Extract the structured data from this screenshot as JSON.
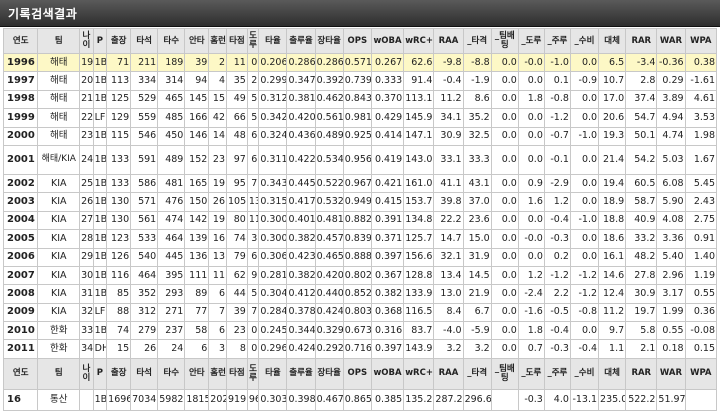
{
  "title": "기록검색결과",
  "headers": [
    "연도",
    "팀",
    "나이",
    "P",
    "출장",
    "타석",
    "타수",
    "안타",
    "홈런",
    "타점",
    "도루",
    "타율",
    "출루율",
    "장타율",
    "OPS",
    "wOBA",
    "wRC+",
    "RAA",
    "_타격",
    "_팀배팅",
    "_도루",
    "_주루",
    "_수비",
    "대체",
    "RAR",
    "WAR",
    "WPA"
  ],
  "headers_display": [
    "연도",
    "팀",
    "나\n이",
    "P",
    "출장",
    "타석",
    "타수",
    "안타",
    "홈런",
    "타점",
    "도\n루",
    "타율",
    "출루율",
    "장타율",
    "OPS",
    "wOBA",
    "wRC+",
    "RAA",
    "_타격",
    "_팀배\n팅",
    "_도루",
    "_주루",
    "_수비",
    "대체",
    "RAR",
    "WAR",
    "WPA"
  ],
  "rows": [
    [
      "1996",
      "해태",
      "19",
      "1B",
      "71",
      "211",
      "189",
      "39",
      "2",
      "11",
      "0",
      "0.206",
      "0.286",
      "0.286",
      "0.571",
      "0.267",
      "62.6",
      "-9.8",
      "-8.8",
      "0.0",
      "-0.0",
      "-1.0",
      "0.0",
      "6.5",
      "-3.4",
      "-0.36",
      "0.38"
    ],
    [
      "1997",
      "해태",
      "20",
      "1B",
      "113",
      "334",
      "314",
      "94",
      "4",
      "35",
      "2",
      "0.299",
      "0.347",
      "0.392",
      "0.739",
      "0.333",
      "91.4",
      "-0.4",
      "-1.9",
      "0.0",
      "0.0",
      "0.1",
      "-0.9",
      "10.7",
      "2.8",
      "0.29",
      "-1.61"
    ],
    [
      "1998",
      "해태",
      "21",
      "1B",
      "125",
      "529",
      "465",
      "145",
      "15",
      "49",
      "5",
      "0.312",
      "0.381",
      "0.462",
      "0.843",
      "0.370",
      "113.1",
      "11.2",
      "8.6",
      "0.0",
      "1.8",
      "-0.8",
      "0.0",
      "17.0",
      "37.4",
      "3.89",
      "4.61"
    ],
    [
      "1999",
      "해태",
      "22",
      "LF",
      "129",
      "559",
      "485",
      "166",
      "42",
      "66",
      "5",
      "0.342",
      "0.420",
      "0.561",
      "0.981",
      "0.429",
      "145.9",
      "34.1",
      "35.2",
      "0.0",
      "0.0",
      "-1.2",
      "0.0",
      "20.6",
      "54.7",
      "4.94",
      "3.53"
    ],
    [
      "2000",
      "해태",
      "23",
      "1B",
      "115",
      "546",
      "450",
      "146",
      "14",
      "48",
      "6",
      "0.324",
      "0.436",
      "0.489",
      "0.925",
      "0.414",
      "147.1",
      "30.9",
      "32.5",
      "0.0",
      "0.0",
      "-0.7",
      "-1.0",
      "19.3",
      "50.1",
      "4.74",
      "1.98"
    ],
    [
      "2001",
      "해태/KIA",
      "24",
      "1B",
      "133",
      "591",
      "489",
      "152",
      "23",
      "97",
      "6",
      "0.311",
      "0.422",
      "0.534",
      "0.956",
      "0.419",
      "143.0",
      "33.1",
      "33.3",
      "0.0",
      "0.0",
      "-0.1",
      "0.0",
      "21.4",
      "54.2",
      "5.03",
      "1.67"
    ],
    [
      "2002",
      "KIA",
      "25",
      "1B",
      "133",
      "586",
      "481",
      "165",
      "19",
      "95",
      "7",
      "0.343",
      "0.445",
      "0.522",
      "0.967",
      "0.421",
      "161.0",
      "41.1",
      "43.1",
      "0.0",
      "0.9",
      "-2.9",
      "0.0",
      "19.4",
      "60.5",
      "6.08",
      "5.45"
    ],
    [
      "2003",
      "KIA",
      "26",
      "1B",
      "130",
      "571",
      "476",
      "150",
      "26",
      "105",
      "13",
      "0.315",
      "0.417",
      "0.532",
      "0.949",
      "0.415",
      "153.7",
      "39.8",
      "37.0",
      "0.0",
      "1.6",
      "1.2",
      "0.0",
      "18.9",
      "58.7",
      "5.90",
      "2.43"
    ],
    [
      "2004",
      "KIA",
      "27",
      "1B",
      "130",
      "561",
      "474",
      "142",
      "19",
      "80",
      "11",
      "0.300",
      "0.401",
      "0.481",
      "0.882",
      "0.391",
      "134.8",
      "22.2",
      "23.6",
      "0.0",
      "0.0",
      "-0.4",
      "-1.0",
      "18.8",
      "40.9",
      "4.08",
      "2.75"
    ],
    [
      "2005",
      "KIA",
      "28",
      "1B",
      "123",
      "533",
      "464",
      "139",
      "16",
      "74",
      "3",
      "0.300",
      "0.382",
      "0.457",
      "0.839",
      "0.371",
      "125.7",
      "14.7",
      "15.0",
      "0.0",
      "-0.0",
      "-0.3",
      "0.0",
      "18.6",
      "33.2",
      "3.36",
      "0.91"
    ],
    [
      "2006",
      "KIA",
      "29",
      "1B",
      "126",
      "540",
      "445",
      "136",
      "13",
      "79",
      "6",
      "0.306",
      "0.423",
      "0.465",
      "0.888",
      "0.397",
      "156.6",
      "32.1",
      "31.9",
      "0.0",
      "0.0",
      "0.2",
      "0.0",
      "16.1",
      "48.2",
      "5.40",
      "1.40"
    ],
    [
      "2007",
      "KIA",
      "30",
      "1B",
      "116",
      "464",
      "395",
      "111",
      "11",
      "62",
      "9",
      "0.281",
      "0.382",
      "0.420",
      "0.802",
      "0.367",
      "128.8",
      "13.4",
      "14.5",
      "0.0",
      "1.2",
      "-1.2",
      "-1.2",
      "14.6",
      "27.8",
      "2.96",
      "1.19"
    ],
    [
      "2008",
      "KIA",
      "31",
      "1B",
      "85",
      "352",
      "293",
      "89",
      "6",
      "44",
      "5",
      "0.304",
      "0.412",
      "0.440",
      "0.852",
      "0.382",
      "133.9",
      "13.0",
      "21.9",
      "0.0",
      "-2.4",
      "2.2",
      "-1.2",
      "12.4",
      "30.9",
      "3.17",
      "0.55"
    ],
    [
      "2009",
      "KIA",
      "32",
      "LF",
      "88",
      "312",
      "271",
      "77",
      "7",
      "39",
      "7",
      "0.284",
      "0.378",
      "0.424",
      "0.803",
      "0.368",
      "116.5",
      "8.4",
      "6.7",
      "0.0",
      "-1.6",
      "-0.5",
      "-0.8",
      "11.2",
      "19.7",
      "1.99",
      "0.36"
    ],
    [
      "2010",
      "한화",
      "33",
      "1B",
      "74",
      "279",
      "237",
      "58",
      "6",
      "23",
      "0",
      "0.245",
      "0.344",
      "0.329",
      "0.673",
      "0.316",
      "83.7",
      "-4.0",
      "-5.9",
      "0.0",
      "1.8",
      "-0.4",
      "0.0",
      "9.7",
      "5.8",
      "0.55",
      "-0.08"
    ],
    [
      "2011",
      "한화",
      "34",
      "DH",
      "15",
      "26",
      "24",
      "6",
      "3",
      "8",
      "0",
      "0.296",
      "0.424",
      "0.292",
      "0.716",
      "0.397",
      "143.9",
      "3.2",
      "3.2",
      "0.0",
      "0.7",
      "-0.3",
      "-0.4",
      "1.1",
      "2.1",
      "0.18",
      "0.15"
    ]
  ],
  "total": [
    "16",
    "통산",
    "",
    "1B",
    "1696",
    "7034",
    "5982",
    "1815",
    "202",
    "919",
    "96",
    "0.303",
    "0.398",
    "0.467",
    "0.865",
    "0.385",
    "135.2",
    "287.2",
    "296.6",
    "",
    "-0.3",
    "4.0",
    "-13.1",
    "235.0",
    "522.2",
    "51.97",
    ""
  ]
}
